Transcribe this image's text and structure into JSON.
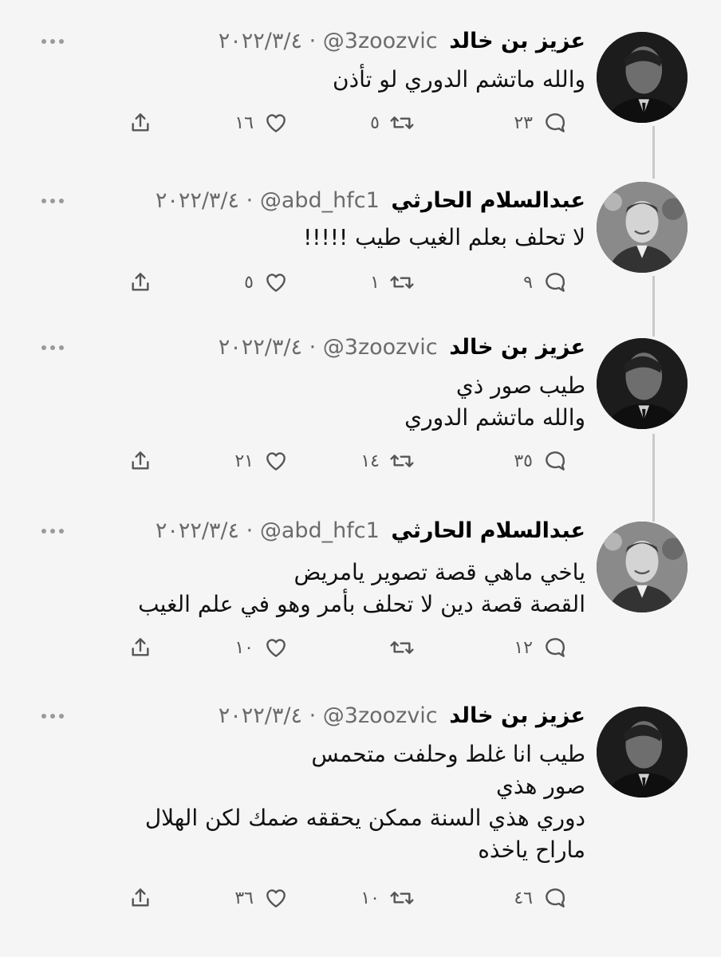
{
  "tweets": [
    {
      "author": "عزيز بن خالد",
      "handle": "@3zoozvic",
      "date": "٢٠٢٢/٣/٤",
      "avatar": "avatar-man-dark-suit",
      "lines": [
        "والله ماتشم الدوري لو تأذن"
      ],
      "replies": "٢٣",
      "retweets": "٥",
      "likes": "١٦"
    },
    {
      "author": "عبدالسلام الحارثي",
      "handle": "@abd_hfc1",
      "date": "٢٠٢٢/٣/٤",
      "avatar": "avatar-smiling-man-suit",
      "lines": [
        "لا تحلف بعلم الغيب طيب !!!!!"
      ],
      "replies": "٩",
      "retweets": "١",
      "likes": "٥"
    },
    {
      "author": "عزيز بن خالد",
      "handle": "@3zoozvic",
      "date": "٢٠٢٢/٣/٤",
      "avatar": "avatar-man-dark-suit",
      "lines": [
        "طيب صور ذي",
        "والله ماتشم الدوري"
      ],
      "replies": "٣٥",
      "retweets": "١٤",
      "likes": "٢١"
    },
    {
      "author": "عبدالسلام الحارثي",
      "handle": "@abd_hfc1",
      "date": "٢٠٢٢/٣/٤",
      "avatar": "avatar-smiling-man-suit",
      "lines": [
        "ياخي ماهي قصة تصوير يامريض",
        "القصة قصة دين لا تحلف بأمر وهو في علم الغيب"
      ],
      "replies": "١٢",
      "retweets": "",
      "likes": "١٠"
    },
    {
      "author": "عزيز بن خالد",
      "handle": "@3zoozvic",
      "date": "٢٠٢٢/٣/٤",
      "avatar": "avatar-man-dark-suit",
      "lines": [
        "طيب انا غلط وحلفت متحمس",
        "صور هذي",
        "دوري هذي السنة ممكن يحققه ضمك لكن الهلال",
        "ماراح ياخذه"
      ],
      "replies": "٤٦",
      "retweets": "١٠",
      "likes": "٣٦"
    }
  ],
  "meta_separator": "·",
  "icons": {
    "reply": "reply-icon",
    "retweet": "retweet-icon",
    "like": "like-icon",
    "share": "share-icon",
    "more": "more-icon"
  },
  "colors": {
    "background": "#f5f5f5",
    "text": "#111111",
    "muted": "#6b6b6b",
    "thread_line": "#c9c9c9"
  }
}
